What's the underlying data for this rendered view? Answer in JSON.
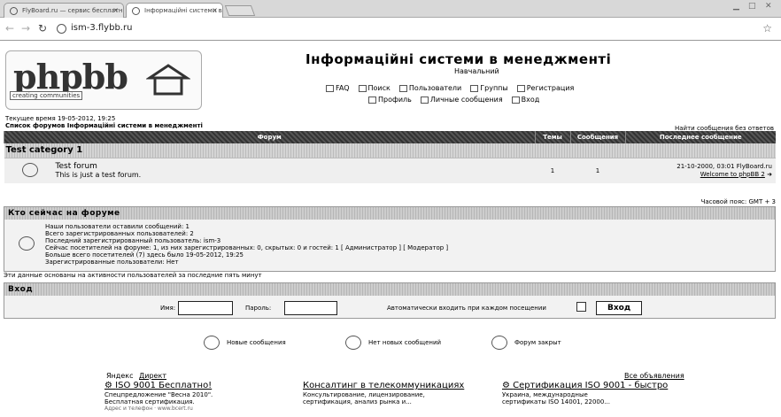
{
  "browser": {
    "tabs": [
      {
        "label": "FlyBoard.ru — сервис бесплатных форумов"
      },
      {
        "label": "Інформаційні системи в менеджменті"
      }
    ],
    "url": "ism-3.flybb.ru"
  },
  "header": {
    "logo_text": "phpbb",
    "logo_sub": "creating communities",
    "site_title": "Інформаційні системи в менеджменті",
    "site_desc": "Навчальний",
    "links_row1": [
      "FAQ",
      "Поиск",
      "Пользователи",
      "Группы",
      "Регистрация"
    ],
    "links_row2": [
      "Профиль",
      "Личные сообщения",
      "Вход"
    ]
  },
  "info": {
    "current_time": "Текущее время 19-05-2012, 19:25",
    "forum_list": "Список форумов Інформаційні системи в менеджменті",
    "unanswered": "Найти сообщения без ответов",
    "timezone": "Часовой пояс: GMT + 3"
  },
  "forum_table": {
    "headers": [
      "Форум",
      "Темы",
      "Сообщения",
      "Последнее сообщение"
    ],
    "category": "Test category 1",
    "forum": {
      "name": "Test forum",
      "desc": "This is just a test forum.",
      "topics": "1",
      "posts": "1",
      "last_date": "21-10-2000, 03:01 FlyBoard.ru",
      "last_link": "Welcome to phpBB 2"
    }
  },
  "who": {
    "title": "Кто сейчас на форуме",
    "lines": [
      "Наши пользователи оставили сообщений: 1",
      "Всего зарегистрированных пользователей: 2",
      "Последний зарегистрированный пользователь: ism-3",
      "Сейчас посетителей на форуме: 1, из них зарегистрированных: 0, скрытых: 0 и гостей: 1   [ Администратор ]   [ Модератор ]",
      "Больше всего посетителей (7) здесь было 19-05-2012, 19:25",
      "Зарегистрированные пользователи: Нет"
    ],
    "footnote": "Эти данные основаны на активности пользователей за последние пять минут"
  },
  "login": {
    "title": "Вход",
    "name_label": "Имя:",
    "password_label": "Пароль:",
    "auto_label": "Автоматически входить при каждом посещении",
    "button": "Вход"
  },
  "legend": {
    "new": "Новые сообщения",
    "no_new": "Нет новых сообщений",
    "locked": "Форум закрыт"
  },
  "ads": {
    "yandex": "Яндекс",
    "direct": "Директ",
    "all": "Все объявления",
    "items": [
      {
        "title": "ISO 9001 Бесплатно!",
        "line1": "Спецпредложение \"Весна 2010\".",
        "line2": "Бесплатная сертификация.",
        "line3": "Адрес и телефон · www.bcert.ru"
      },
      {
        "title": "Консалтинг в телекоммуникациях",
        "line1": "Консультирование, лицензирование,",
        "line2": "сертификация, анализ рынка и...",
        "line3": ""
      },
      {
        "title": "Сертификация ISO 9001 - быстро",
        "line1": "Украина, международные",
        "line2": "сертификаты ISO 14001, 22000...",
        "line3": ""
      }
    ]
  }
}
